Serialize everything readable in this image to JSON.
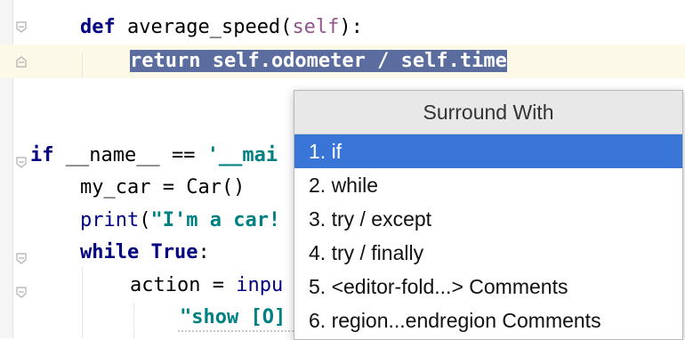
{
  "editor": {
    "lines": [
      {
        "tokens": [
          {
            "t": "def",
            "c": "kw"
          },
          {
            "t": " average_speed(",
            "c": ""
          },
          {
            "t": "self",
            "c": "selfkw"
          },
          {
            "t": "):",
            "c": ""
          }
        ]
      },
      {
        "tokens": [
          {
            "t": "return self.odometer / self.time",
            "c": "sel"
          }
        ]
      },
      {
        "tokens": []
      },
      {
        "tokens": [
          {
            "t": "if",
            "c": "kw"
          },
          {
            "t": " __name__ == ",
            "c": ""
          },
          {
            "t": "'__mai",
            "c": "str"
          }
        ]
      },
      {
        "tokens": [
          {
            "t": "my_car = Car()",
            "c": ""
          }
        ]
      },
      {
        "tokens": [
          {
            "t": "print",
            "c": "builtin"
          },
          {
            "t": "(",
            "c": ""
          },
          {
            "t": "\"I'm a car!",
            "c": "str"
          }
        ]
      },
      {
        "tokens": [
          {
            "t": "while",
            "c": "kw"
          },
          {
            "t": " ",
            "c": ""
          },
          {
            "t": "True",
            "c": "kw"
          },
          {
            "t": ":",
            "c": ""
          }
        ]
      },
      {
        "tokens": [
          {
            "t": "action = ",
            "c": ""
          },
          {
            "t": "inpu",
            "c": "builtin"
          }
        ]
      },
      {
        "tokens": [
          {
            "t": "\"show [O]",
            "c": "str"
          }
        ]
      }
    ]
  },
  "popup": {
    "title": "Surround With",
    "items": [
      "1. if",
      "2. while",
      "3. try / except",
      "4. try / finally",
      "5. <editor-fold...> Comments",
      "6. region...endregion Comments"
    ],
    "selected_index": 0
  },
  "colors": {
    "keyword": "#000080",
    "string": "#008080",
    "self": "#94558d",
    "selection": "#5b6d9e",
    "popup_selected": "#3875d7"
  }
}
